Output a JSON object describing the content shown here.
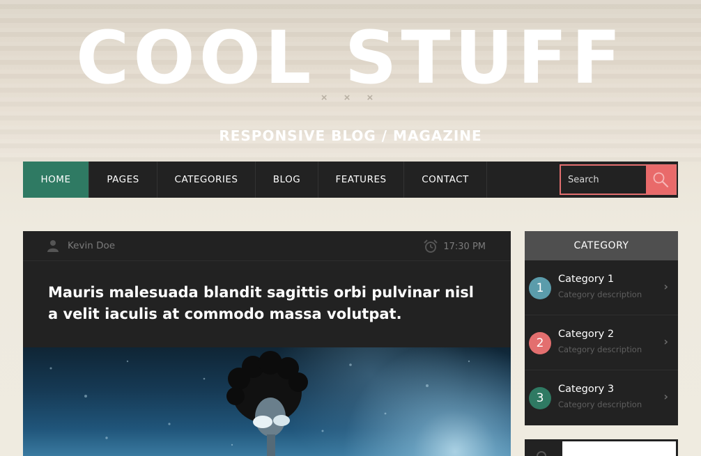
{
  "header": {
    "site_title": "COOL STUFF",
    "ornament": "× × ×",
    "tagline": "RESPONSIVE BLOG / MAGAZINE"
  },
  "nav": {
    "items": [
      {
        "label": "HOME",
        "active": true
      },
      {
        "label": "PAGES",
        "active": false
      },
      {
        "label": "CATEGORIES",
        "active": false
      },
      {
        "label": "BLOG",
        "active": false
      },
      {
        "label": "FEATURES",
        "active": false
      },
      {
        "label": "CONTACT",
        "active": false
      }
    ],
    "search": {
      "placeholder": "Search",
      "icon": "search-icon"
    }
  },
  "post": {
    "author": "Kevin Doe",
    "author_icon": "user-icon",
    "time": "17:30 PM",
    "time_icon": "alarm-clock-icon",
    "title": "Mauris malesuada blandit sagittis orbi pulvinar nisl a velit iaculis at commodo massa volutpat."
  },
  "sidebar": {
    "category_widget": {
      "title": "CATEGORY",
      "items": [
        {
          "number": "1",
          "name": "Category 1",
          "description": "Category description",
          "color": "#5b9cab"
        },
        {
          "number": "2",
          "name": "Category 2",
          "description": "Category description",
          "color": "#e36f6f"
        },
        {
          "number": "3",
          "name": "Category 3",
          "description": "Category description",
          "color": "#2f7a63"
        }
      ],
      "chevron": "›"
    }
  },
  "colors": {
    "accent_green": "#2f7a63",
    "accent_red": "#e96a6a",
    "dark": "#222222"
  }
}
